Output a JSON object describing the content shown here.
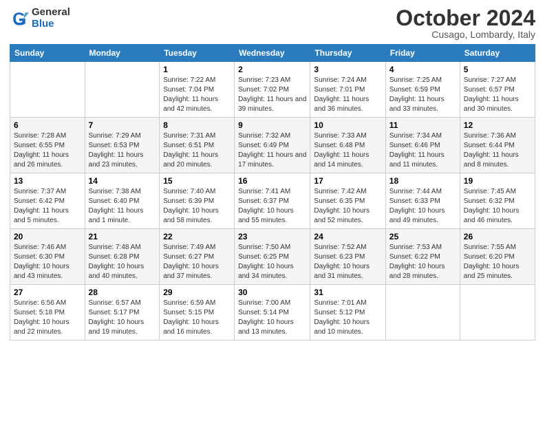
{
  "header": {
    "logo_line1": "General",
    "logo_line2": "Blue",
    "month": "October 2024",
    "location": "Cusago, Lombardy, Italy"
  },
  "weekdays": [
    "Sunday",
    "Monday",
    "Tuesday",
    "Wednesday",
    "Thursday",
    "Friday",
    "Saturday"
  ],
  "weeks": [
    [
      {
        "day": "",
        "info": ""
      },
      {
        "day": "",
        "info": ""
      },
      {
        "day": "1",
        "info": "Sunrise: 7:22 AM\nSunset: 7:04 PM\nDaylight: 11 hours and 42 minutes."
      },
      {
        "day": "2",
        "info": "Sunrise: 7:23 AM\nSunset: 7:02 PM\nDaylight: 11 hours and 39 minutes."
      },
      {
        "day": "3",
        "info": "Sunrise: 7:24 AM\nSunset: 7:01 PM\nDaylight: 11 hours and 36 minutes."
      },
      {
        "day": "4",
        "info": "Sunrise: 7:25 AM\nSunset: 6:59 PM\nDaylight: 11 hours and 33 minutes."
      },
      {
        "day": "5",
        "info": "Sunrise: 7:27 AM\nSunset: 6:57 PM\nDaylight: 11 hours and 30 minutes."
      }
    ],
    [
      {
        "day": "6",
        "info": "Sunrise: 7:28 AM\nSunset: 6:55 PM\nDaylight: 11 hours and 26 minutes."
      },
      {
        "day": "7",
        "info": "Sunrise: 7:29 AM\nSunset: 6:53 PM\nDaylight: 11 hours and 23 minutes."
      },
      {
        "day": "8",
        "info": "Sunrise: 7:31 AM\nSunset: 6:51 PM\nDaylight: 11 hours and 20 minutes."
      },
      {
        "day": "9",
        "info": "Sunrise: 7:32 AM\nSunset: 6:49 PM\nDaylight: 11 hours and 17 minutes."
      },
      {
        "day": "10",
        "info": "Sunrise: 7:33 AM\nSunset: 6:48 PM\nDaylight: 11 hours and 14 minutes."
      },
      {
        "day": "11",
        "info": "Sunrise: 7:34 AM\nSunset: 6:46 PM\nDaylight: 11 hours and 11 minutes."
      },
      {
        "day": "12",
        "info": "Sunrise: 7:36 AM\nSunset: 6:44 PM\nDaylight: 11 hours and 8 minutes."
      }
    ],
    [
      {
        "day": "13",
        "info": "Sunrise: 7:37 AM\nSunset: 6:42 PM\nDaylight: 11 hours and 5 minutes."
      },
      {
        "day": "14",
        "info": "Sunrise: 7:38 AM\nSunset: 6:40 PM\nDaylight: 11 hours and 1 minute."
      },
      {
        "day": "15",
        "info": "Sunrise: 7:40 AM\nSunset: 6:39 PM\nDaylight: 10 hours and 58 minutes."
      },
      {
        "day": "16",
        "info": "Sunrise: 7:41 AM\nSunset: 6:37 PM\nDaylight: 10 hours and 55 minutes."
      },
      {
        "day": "17",
        "info": "Sunrise: 7:42 AM\nSunset: 6:35 PM\nDaylight: 10 hours and 52 minutes."
      },
      {
        "day": "18",
        "info": "Sunrise: 7:44 AM\nSunset: 6:33 PM\nDaylight: 10 hours and 49 minutes."
      },
      {
        "day": "19",
        "info": "Sunrise: 7:45 AM\nSunset: 6:32 PM\nDaylight: 10 hours and 46 minutes."
      }
    ],
    [
      {
        "day": "20",
        "info": "Sunrise: 7:46 AM\nSunset: 6:30 PM\nDaylight: 10 hours and 43 minutes."
      },
      {
        "day": "21",
        "info": "Sunrise: 7:48 AM\nSunset: 6:28 PM\nDaylight: 10 hours and 40 minutes."
      },
      {
        "day": "22",
        "info": "Sunrise: 7:49 AM\nSunset: 6:27 PM\nDaylight: 10 hours and 37 minutes."
      },
      {
        "day": "23",
        "info": "Sunrise: 7:50 AM\nSunset: 6:25 PM\nDaylight: 10 hours and 34 minutes."
      },
      {
        "day": "24",
        "info": "Sunrise: 7:52 AM\nSunset: 6:23 PM\nDaylight: 10 hours and 31 minutes."
      },
      {
        "day": "25",
        "info": "Sunrise: 7:53 AM\nSunset: 6:22 PM\nDaylight: 10 hours and 28 minutes."
      },
      {
        "day": "26",
        "info": "Sunrise: 7:55 AM\nSunset: 6:20 PM\nDaylight: 10 hours and 25 minutes."
      }
    ],
    [
      {
        "day": "27",
        "info": "Sunrise: 6:56 AM\nSunset: 5:18 PM\nDaylight: 10 hours and 22 minutes."
      },
      {
        "day": "28",
        "info": "Sunrise: 6:57 AM\nSunset: 5:17 PM\nDaylight: 10 hours and 19 minutes."
      },
      {
        "day": "29",
        "info": "Sunrise: 6:59 AM\nSunset: 5:15 PM\nDaylight: 10 hours and 16 minutes."
      },
      {
        "day": "30",
        "info": "Sunrise: 7:00 AM\nSunset: 5:14 PM\nDaylight: 10 hours and 13 minutes."
      },
      {
        "day": "31",
        "info": "Sunrise: 7:01 AM\nSunset: 5:12 PM\nDaylight: 10 hours and 10 minutes."
      },
      {
        "day": "",
        "info": ""
      },
      {
        "day": "",
        "info": ""
      }
    ]
  ]
}
